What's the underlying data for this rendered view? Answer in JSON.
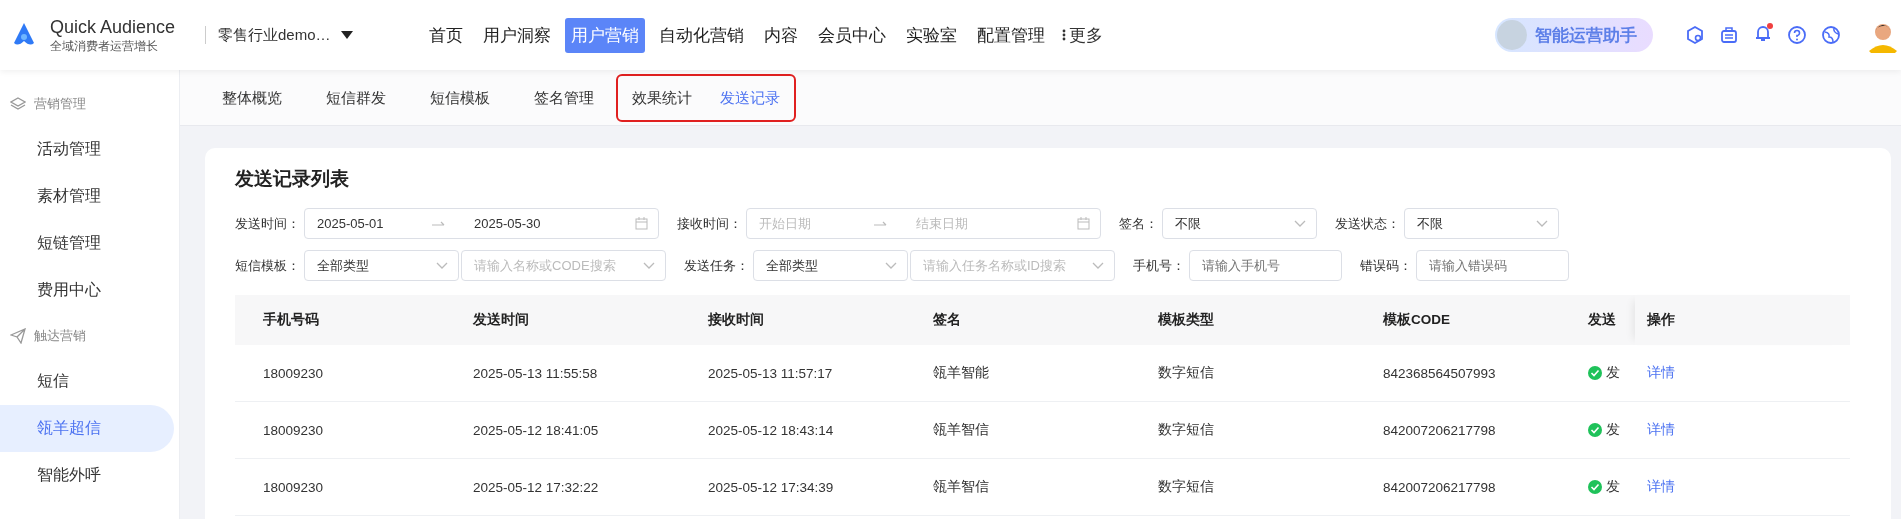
{
  "header": {
    "logo_title": "Quick Audience",
    "logo_subtitle": "全域消费者运营增长",
    "workspace": "零售行业demo…",
    "nav": [
      {
        "label": "首页",
        "selected": false
      },
      {
        "label": "用户洞察",
        "selected": false
      },
      {
        "label": "用户营销",
        "selected": true
      },
      {
        "label": "自动化营销",
        "selected": false
      },
      {
        "label": "内容",
        "selected": false
      },
      {
        "label": "会员中心",
        "selected": false
      },
      {
        "label": "实验室",
        "selected": false
      },
      {
        "label": "配置管理",
        "selected": false
      }
    ],
    "more": "更多",
    "assistant": "智能运营助手",
    "notification_unread": true
  },
  "sidebar": {
    "groups": [
      {
        "label": "营销管理",
        "items": [
          {
            "label": "活动管理",
            "selected": false
          },
          {
            "label": "素材管理",
            "selected": false
          },
          {
            "label": "短链管理",
            "selected": false
          },
          {
            "label": "费用中心",
            "selected": false
          }
        ]
      },
      {
        "label": "触达营销",
        "items": [
          {
            "label": "短信",
            "selected": false
          },
          {
            "label": "瓴羊超信",
            "selected": true
          },
          {
            "label": "智能外呼",
            "selected": false
          }
        ]
      }
    ]
  },
  "subtabs": [
    {
      "label": "整体概览",
      "selected": false,
      "highlighted": false
    },
    {
      "label": "短信群发",
      "selected": false,
      "highlighted": false
    },
    {
      "label": "短信模板",
      "selected": false,
      "highlighted": false
    },
    {
      "label": "签名管理",
      "selected": false,
      "highlighted": false
    },
    {
      "label": "效果统计",
      "selected": false,
      "highlighted": true
    },
    {
      "label": "发送记录",
      "selected": true,
      "highlighted": true
    }
  ],
  "panel": {
    "title": "发送记录列表",
    "filter_rows": [
      [
        {
          "label": "发送时间：",
          "controls": [
            {
              "kind": "date_range",
              "start": "2025-05-01",
              "end": "2025-05-30"
            }
          ]
        },
        {
          "label": "接收时间：",
          "controls": [
            {
              "kind": "date_range",
              "start_placeholder": "开始日期",
              "end_placeholder": "结束日期"
            }
          ]
        },
        {
          "label": "签名：",
          "controls": [
            {
              "kind": "select",
              "value": "不限"
            }
          ]
        },
        {
          "label": "发送状态：",
          "controls": [
            {
              "kind": "select",
              "value": "不限"
            }
          ]
        }
      ],
      [
        {
          "label": "短信模板：",
          "controls": [
            {
              "kind": "select",
              "value": "全部类型"
            },
            {
              "kind": "select",
              "placeholder": "请输入名称或CODE搜索"
            }
          ]
        },
        {
          "label": "发送任务：",
          "controls": [
            {
              "kind": "select",
              "value": "全部类型"
            },
            {
              "kind": "select",
              "placeholder": "请输入任务名称或ID搜索"
            }
          ]
        },
        {
          "label": "手机号：",
          "controls": [
            {
              "kind": "input",
              "placeholder": "请输入手机号"
            }
          ]
        },
        {
          "label": "错误码：",
          "controls": [
            {
              "kind": "input",
              "placeholder": "请输入错误码"
            }
          ]
        }
      ]
    ],
    "table": {
      "columns": [
        "手机号码",
        "发送时间",
        "接收时间",
        "签名",
        "模板类型",
        "模板CODE",
        "发送",
        "操作"
      ],
      "rows": [
        {
          "phone": "18009230",
          "send_time": "2025-05-13 11:55:58",
          "receive_time": "2025-05-13 11:57:17",
          "signature": "瓴羊智能",
          "template_type": "数字短信",
          "template_code": "842368564507993",
          "status": "发",
          "status_ok": true,
          "action": "详情"
        },
        {
          "phone": "18009230",
          "send_time": "2025-05-12 18:41:05",
          "receive_time": "2025-05-12 18:43:14",
          "signature": "瓴羊智信",
          "template_type": "数字短信",
          "template_code": "842007206217798",
          "status": "发",
          "status_ok": true,
          "action": "详情"
        },
        {
          "phone": "18009230",
          "send_time": "2025-05-12 17:32:22",
          "receive_time": "2025-05-12 17:34:39",
          "signature": "瓴羊智信",
          "template_type": "数字短信",
          "template_code": "842007206217798",
          "status": "发",
          "status_ok": true,
          "action": "详情"
        }
      ]
    }
  }
}
